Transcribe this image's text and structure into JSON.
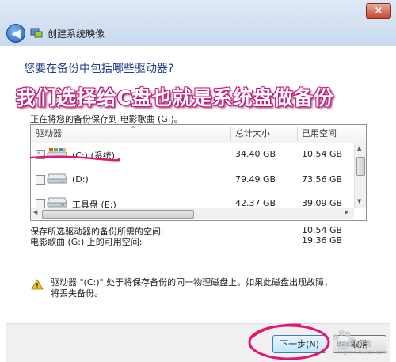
{
  "window": {
    "title": "创建系统映像",
    "close_glyph": "×",
    "back_glyph": "◀"
  },
  "heading": "您要在备份中包括哪些驱动器?",
  "overlay_text": "我们选择给C盘也就是系统盘做备份",
  "saving_to": "正在将您的备份保存到 电影歌曲 (G:)。",
  "table": {
    "columns": [
      "驱动器",
      "总计大小",
      "已用空间"
    ],
    "rows": [
      {
        "name": "(C:) (系统)",
        "total": "34.40 GB",
        "used": "10.54 GB",
        "checked": true,
        "disabled": true,
        "icon": "windows-drive-icon"
      },
      {
        "name": "(D:)",
        "total": "79.49 GB",
        "used": "73.56 GB",
        "checked": false,
        "disabled": false,
        "icon": "hard-drive-icon"
      },
      {
        "name": "工具盘 (E:)",
        "total": "42.37 GB",
        "used": "39.09 GB",
        "checked": false,
        "disabled": false,
        "icon": "hard-drive-icon"
      }
    ]
  },
  "stats": {
    "required_label": "保存所选驱动器的备份所需的空间:",
    "required_value": "10.54 GB",
    "available_label": "电影歌曲 (G:) 上的可用空间:",
    "available_value": "19.36 GB"
  },
  "warning": "驱动器 \"(C:)\" 处于将保存备份的同一物理磁盘上。如果此磁盘出现故障，将丢失备份。",
  "buttons": {
    "next": "下一步(N)",
    "cancel": "取消"
  },
  "watermark": {
    "text": "Baidu经验",
    "sub": "jingyan.baidu.com"
  },
  "colors": {
    "annotation": "#e0186f",
    "heading": "#1e3a8a",
    "overlay_outline": "#c2187a"
  }
}
